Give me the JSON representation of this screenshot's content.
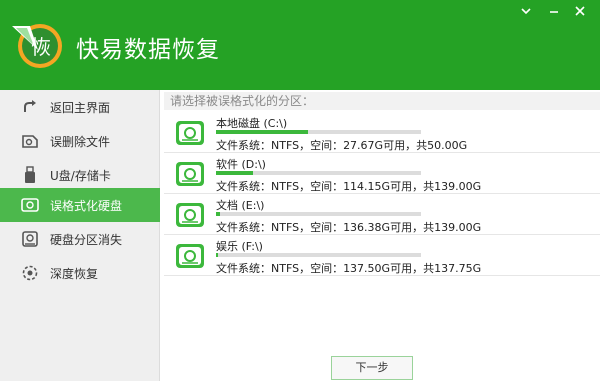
{
  "app": {
    "title": "快易数据恢复",
    "logo_char": "恢"
  },
  "window_controls": [
    {
      "name": "chevron-down-icon",
      "label": "collapse"
    },
    {
      "name": "minimize-icon",
      "label": "minimize"
    },
    {
      "name": "close-icon",
      "label": "close"
    }
  ],
  "sidebar": {
    "items": [
      {
        "label": "返回主界面",
        "icon": "back-arrow-icon",
        "active": false
      },
      {
        "label": "误删除文件",
        "icon": "file-icon",
        "active": false
      },
      {
        "label": "U盘/存储卡",
        "icon": "usb-drive-icon",
        "active": false
      },
      {
        "label": "误格式化硬盘",
        "icon": "hard-disk-icon",
        "active": true
      },
      {
        "label": "硬盘分区消失",
        "icon": "disk-partition-icon",
        "active": false
      },
      {
        "label": "深度恢复",
        "icon": "deep-scan-icon",
        "active": false
      }
    ]
  },
  "main": {
    "prompt": "请选择被误格式化的分区：",
    "partitions": [
      {
        "name": "本地磁盘 (C:\\)",
        "info": "文件系统：NTFS，空间：27.67G可用，共50.00G",
        "used_fraction": 0.45
      },
      {
        "name": "软件 (D:\\)",
        "info": "文件系统：NTFS，空间：114.15G可用，共139.00G",
        "used_fraction": 0.18
      },
      {
        "name": "文档 (E:\\)",
        "info": "文件系统：NTFS，空间：136.38G可用，共139.00G",
        "used_fraction": 0.02
      },
      {
        "name": "娱乐 (F:\\)",
        "info": "文件系统：NTFS，空间：137.50G可用，共137.75G",
        "used_fraction": 0.01
      }
    ],
    "next_label": "下一步"
  },
  "colors": {
    "header": "#25a225",
    "active_item": "#4cb84c",
    "bar_fill": "#3cb83c",
    "disk_icon": "#3cb83c"
  }
}
